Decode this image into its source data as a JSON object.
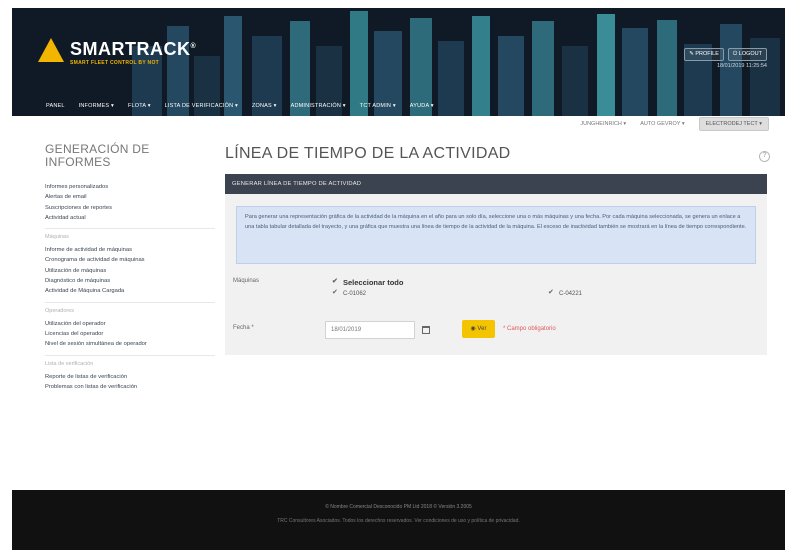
{
  "brand": {
    "name": "SMARTRACK",
    "registered": "®",
    "tagline": "SMART FLEET CONTROL BY NOT"
  },
  "header_buttons": [
    {
      "label": "✎ PROFILE",
      "name": "profile-button"
    },
    {
      "label": "⏻ LOGOUT",
      "name": "logout-button"
    }
  ],
  "header_datetime": "18/01/2019 11:25:54",
  "menu": [
    "PANEL",
    "INFORMES ▾",
    "FLOTA ▾",
    "LISTA DE VERIFICACIÓN ▾",
    "ZONAS ▾",
    "ADMINISTRACIÓN ▾",
    "TCT ADMIN ▾",
    "AYUDA ▾"
  ],
  "subbar": {
    "items": [
      "JUNGHEINRICH ▾",
      "AUTO GEVROY ▾"
    ],
    "button": "ELECTRODEJ TECT ▾"
  },
  "sidebar": {
    "title": "GENERACIÓN DE INFORMES",
    "group1": [
      "Informes personalizados",
      "Alertas de email",
      "Suscripciones de reportes",
      "Actividad actual"
    ],
    "section_machines": "Máquinas",
    "group2": [
      "Informe de actividad de máquinas",
      "Cronograma de actividad de máquinas",
      "Utilización de máquinas",
      "Diagnóstico de máquinas",
      "Actividad de Máquina Cargada"
    ],
    "section_operators": "Operadores",
    "group3": [
      "Utilización del operador",
      "Licencias del operador",
      "Nivel de sesión simultánea de operador"
    ],
    "section_checklist": "Lista de verificación",
    "group4": [
      "Reporte de listas de verificación",
      "Problemas con listas de verificación"
    ]
  },
  "main": {
    "title": "LÍNEA DE TIEMPO DE LA ACTIVIDAD",
    "panel_header": "GENERAR LÍNEA DE TIEMPO DE ACTIVIDAD",
    "info": "Para generar una representación gráfica de la actividad de la máquina en el año para un solo día, seleccione una o más máquinas y una fecha. Por cada máquina seleccionada, se genera un enlace a una tabla tabular detallada del trayecto, y una gráfica que muestra una línea de tiempo de la actividad de la máquina. El exceso de inactividad también se mostrará en la línea de tiempo correspondiente.",
    "machines_label": "Máquinas",
    "select_all": "Seleccionar todo",
    "machines": [
      "C-01062",
      "C-04221"
    ],
    "date_label": "Fecha *",
    "date_value": "18/01/2019",
    "view_button": "◉ Ver",
    "required_text": "* Campo obligatorio"
  },
  "footer": {
    "line1": "© Nombre Comercial Desconocido PM Ltd 2018 © Versión 3.2005",
    "line2": "TRC Consultores Asociados. Todos los derechos reservados. Ver condiciones de uso y política de privacidad."
  },
  "colors": {
    "accent": "#f5c400",
    "header_bg": "#0f1a26",
    "panel_head": "#3c4350",
    "info_bg": "#d8e4f6"
  }
}
